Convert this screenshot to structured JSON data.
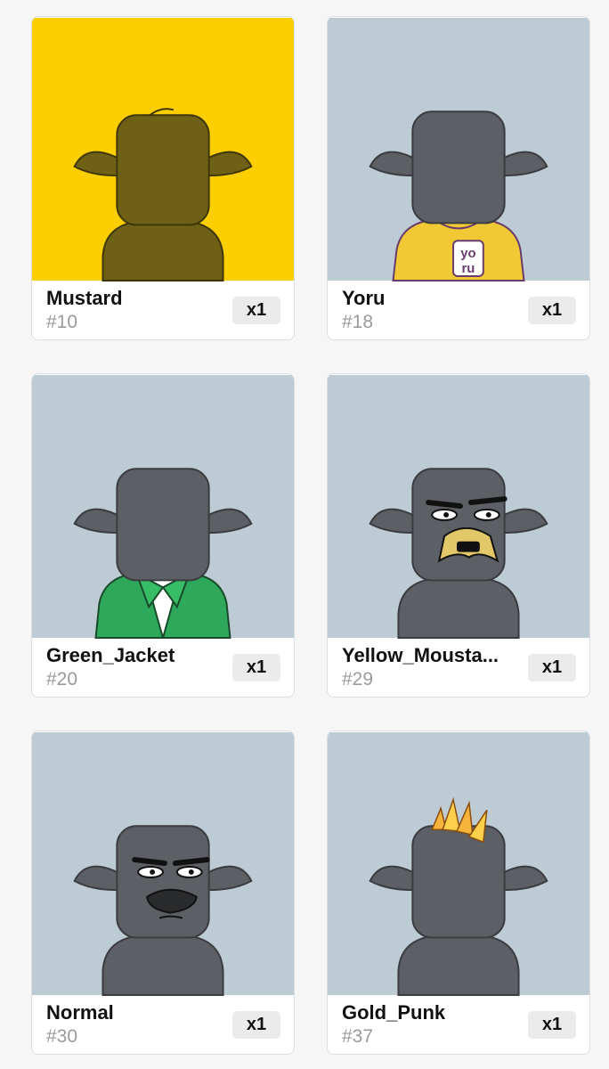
{
  "items": [
    {
      "name": "Mustard",
      "number": "#10",
      "quantity": "x1",
      "background": "#fecf00",
      "trait": "mustard-color"
    },
    {
      "name": "Yoru",
      "number": "#18",
      "quantity": "x1",
      "background": "#bdcbd5",
      "trait": "yoru-shirt",
      "shirt_text": "yoru"
    },
    {
      "name": "Green_Jacket",
      "number": "#20",
      "quantity": "x1",
      "background": "#bdcbd5",
      "trait": "green-jacket"
    },
    {
      "name": "Yellow_Mousta...",
      "number": "#29",
      "quantity": "x1",
      "background": "#bdcbd5",
      "trait": "yellow-moustache"
    },
    {
      "name": "Normal",
      "number": "#30",
      "quantity": "x1",
      "background": "#bdcbd5",
      "trait": "normal-face"
    },
    {
      "name": "Gold_Punk",
      "number": "#37",
      "quantity": "x1",
      "background": "#bdcbd5",
      "trait": "gold-punk-hair"
    }
  ]
}
